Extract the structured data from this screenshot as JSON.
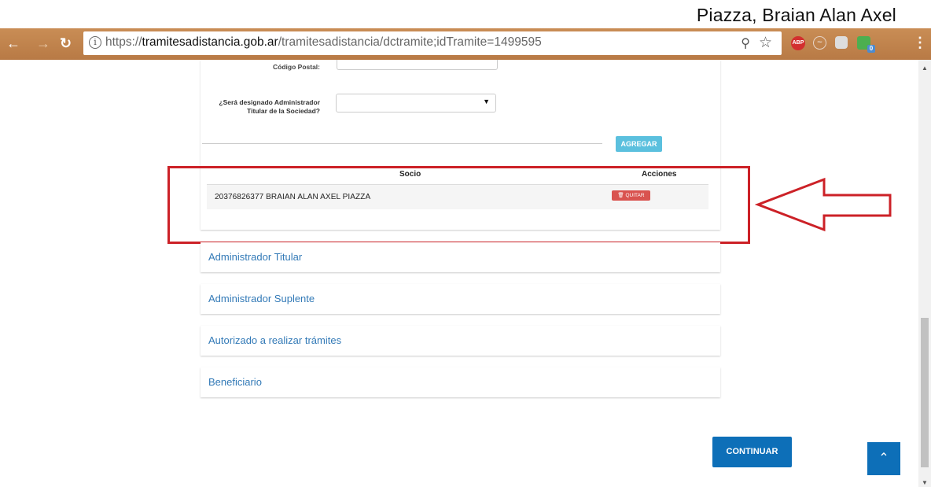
{
  "caption": "Piazza, Braian Alan Axel",
  "browser": {
    "url_scheme": "https://",
    "url_host": "tramitesadistancia.gob.ar",
    "url_path": "/tramitesadistancia/dctramite;idTramite=1499595",
    "ext_abp_label": "ABP",
    "ext_badge": "0"
  },
  "form": {
    "codigo_postal_label": "Código Postal:",
    "administrador_label": "¿Será designado Administrador Titular de la Sociedad?",
    "administrador_value": "",
    "agregar_button": "AGREGAR"
  },
  "table": {
    "headers": [
      "Socio",
      "Acciones"
    ],
    "rows": [
      {
        "socio": "20376826377 BRAIAN ALAN AXEL PIAZZA",
        "accion": "QUITAR"
      }
    ]
  },
  "sections": [
    "Administrador Titular",
    "Administrador Suplente",
    "Autorizado a realizar trámites",
    "Beneficiario"
  ],
  "continuar_button": "CONTINUAR",
  "annotation_color": "#cc2127",
  "accent_color": "#0d6fb8"
}
